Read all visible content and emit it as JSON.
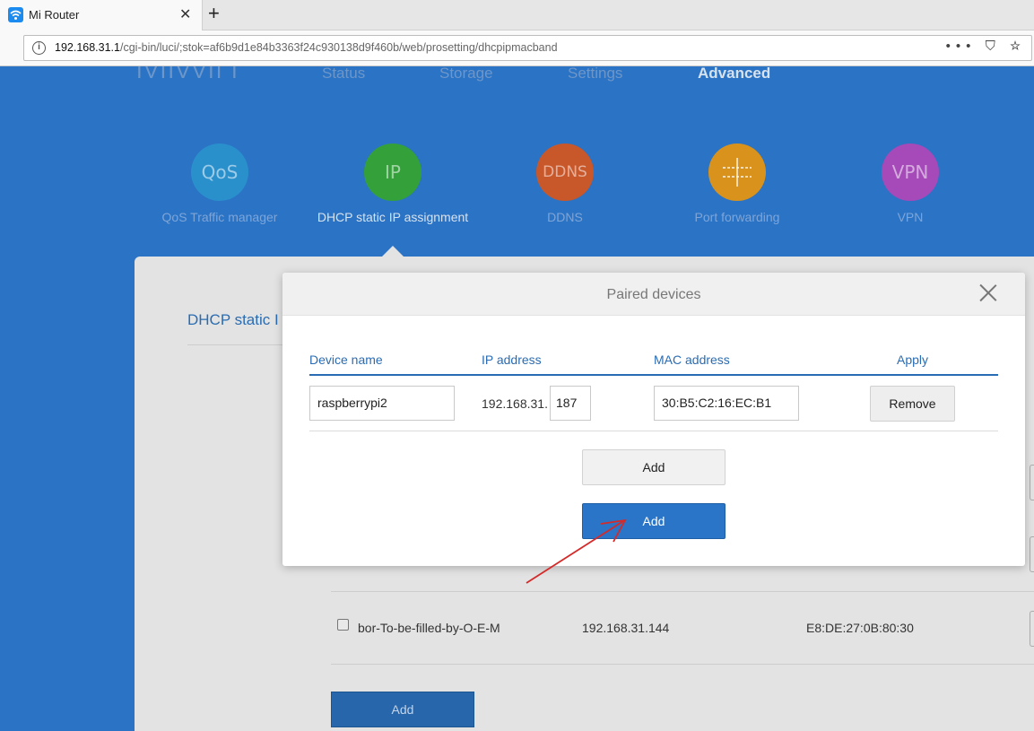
{
  "browser": {
    "tab_title": "Mi Router",
    "url_host": "192.168.31.1",
    "url_path": "/cgi-bin/luci/;stok=af6b9d1e84b3363f24c930138d9f460b/web/prosetting/dhcpipmacband",
    "actions": "••• ⛉ ☆"
  },
  "header": {
    "logo": "IVIIVVII I",
    "nav": [
      "Status",
      "Storage",
      "Settings",
      "Advanced"
    ]
  },
  "features": [
    {
      "icon": "QoS",
      "label": "QoS Traffic manager",
      "color": "#2a90cc"
    },
    {
      "icon": "IP",
      "label": "DHCP static IP assignment",
      "color": "#34a03a"
    },
    {
      "icon": "DDNS",
      "label": "DDNS",
      "color": "#c8572a"
    },
    {
      "icon": "",
      "label": "Port forwarding",
      "color": "#d9931c"
    },
    {
      "icon": "VPN",
      "label": "VPN",
      "color": "#a54ab8"
    }
  ],
  "background_section": {
    "title": "DHCP static I",
    "row": {
      "name": "bor-To-be-filled-by-O-E-M",
      "ip": "192.168.31.144",
      "mac": "E8:DE:27:0B:80:30"
    },
    "add_label": "Add"
  },
  "modal": {
    "title": "Paired devices",
    "columns": [
      "Device name",
      "IP address",
      "MAC address",
      "Apply"
    ],
    "row": {
      "device_name": "raspberrypi2",
      "ip_prefix": "192.168.31.",
      "ip_last": "187",
      "mac": "30:B5:C2:16:EC:B1",
      "remove_label": "Remove"
    },
    "add_label": "Add",
    "add_primary_label": "Add"
  }
}
